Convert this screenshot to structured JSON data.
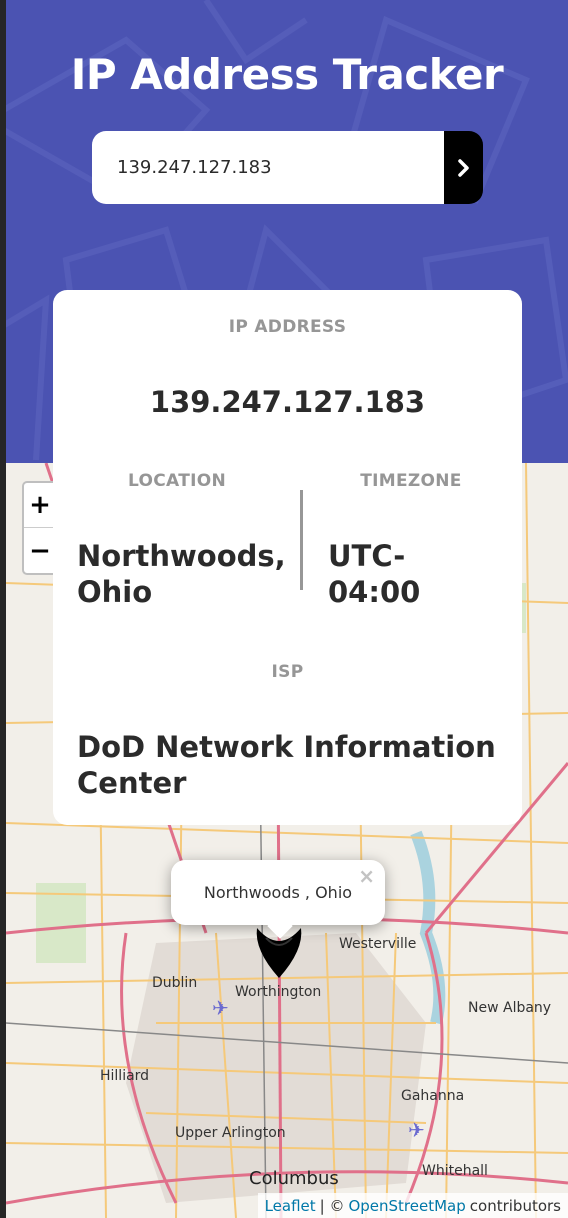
{
  "header": {
    "title": "IP Address Tracker"
  },
  "search": {
    "value": "139.247.127.183",
    "button_icon": "chevron-right-icon"
  },
  "info": {
    "ip_label": "IP ADDRESS",
    "ip_value": "139.247.127.183",
    "location_label": "LOCATION",
    "location_value": "Northwoods, Ohio",
    "timezone_label": "TIMEZONE",
    "timezone_value": "UTC-04:00",
    "isp_label": "ISP",
    "isp_value": "DoD Network Information Center"
  },
  "map": {
    "zoom_in": "+",
    "zoom_out": "−",
    "popup_text": "Northwoods , Ohio",
    "popup_close": "×",
    "places": {
      "westerville": "Westerville",
      "dublin": "Dublin",
      "worthington": "Worthington",
      "new_albany": "New Albany",
      "hilliard": "Hilliard",
      "gahanna": "Gahanna",
      "upper_arlington": "Upper Arlington",
      "columbus": "Columbus",
      "whitehall": "Whitehall"
    },
    "attribution": {
      "leaflet": "Leaflet",
      "separator": "| ©",
      "osm": "OpenStreetMap",
      "contributors": "contributors"
    }
  },
  "colors": {
    "header_bg": "#4b53b2",
    "dark": "#2b2b2b",
    "label_gray": "#969696",
    "link": "#0078a8"
  }
}
